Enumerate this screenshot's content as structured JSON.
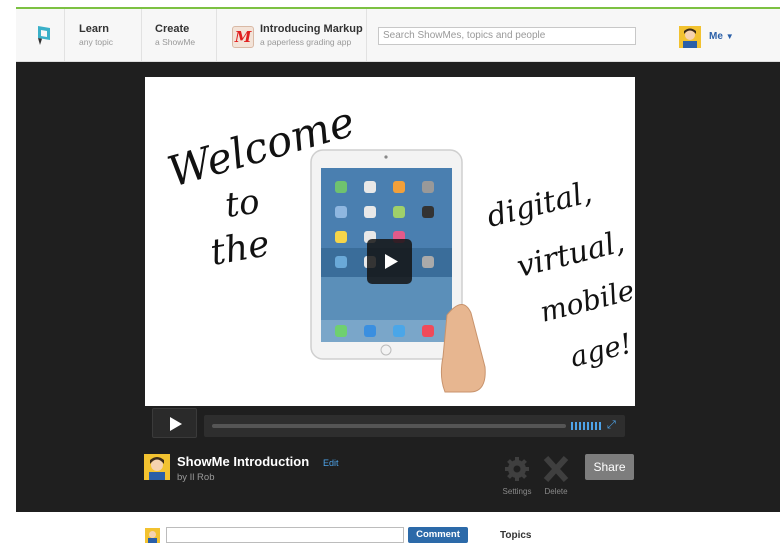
{
  "header": {
    "nav": [
      {
        "title": "Learn",
        "subtitle": "any topic"
      },
      {
        "title": "Create",
        "subtitle": "a ShowMe"
      },
      {
        "title": "Introducing Markup",
        "subtitle": "a paperless grading app"
      }
    ],
    "markup_logo_letter": "M",
    "search_placeholder": "Search ShowMes, topics and people",
    "user_label": "Me",
    "accent_color": "#7cc142"
  },
  "video": {
    "slide_text_left": [
      "Welcome",
      "to",
      "the"
    ],
    "slide_text_right": [
      "digital,",
      "virtual,",
      "mobile",
      "age!"
    ],
    "title": "ShowMe Introduction",
    "edit_label": "Edit",
    "byline": "by Il Rob",
    "settings_label": "Settings",
    "delete_label": "Delete",
    "share_label": "Share",
    "progress": 0
  },
  "comments": {
    "button_label": "Comment",
    "topics_heading": "Topics"
  }
}
